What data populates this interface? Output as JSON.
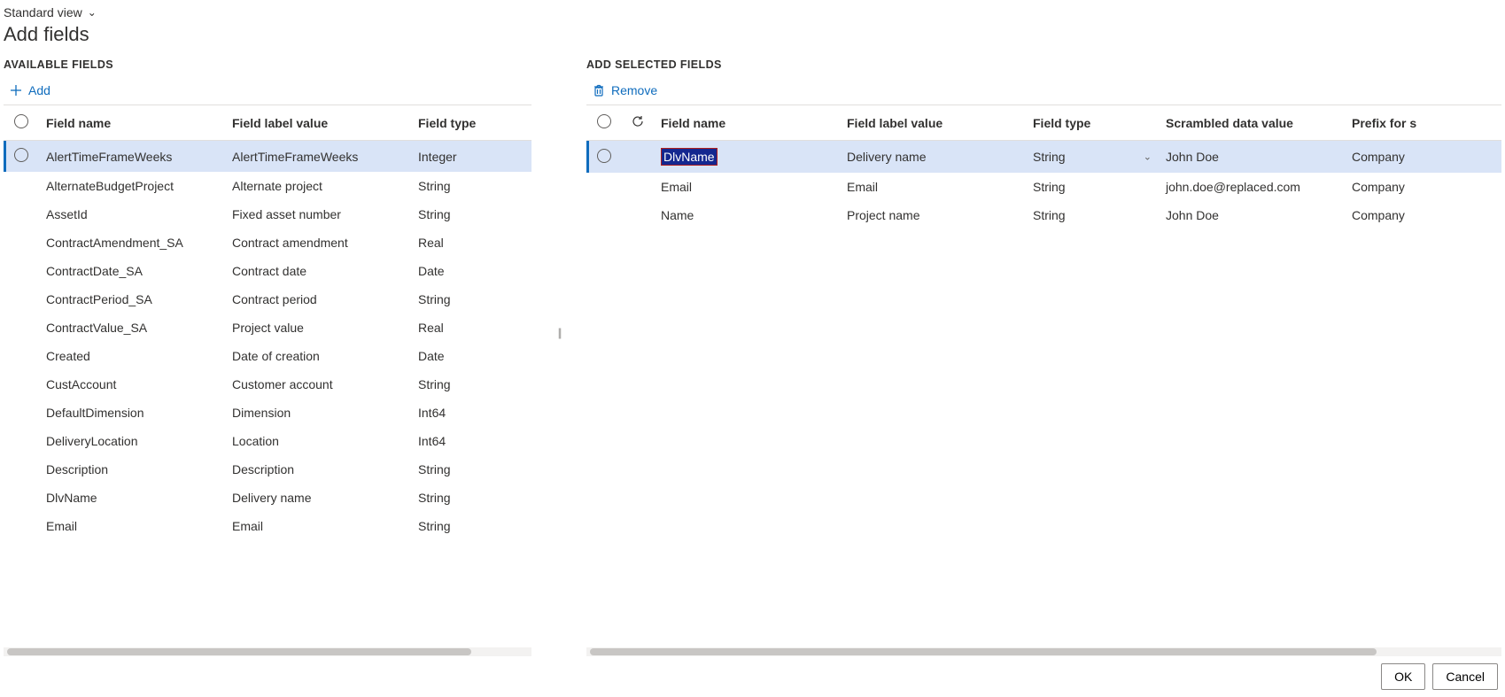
{
  "viewSelector": "Standard view",
  "pageTitle": "Add fields",
  "left": {
    "heading": "AVAILABLE FIELDS",
    "addLabel": "Add",
    "columns": {
      "name": "Field name",
      "label": "Field label value",
      "type": "Field type"
    },
    "rows": [
      {
        "name": "AlertTimeFrameWeeks",
        "label": "AlertTimeFrameWeeks",
        "type": "Integer",
        "selected": true
      },
      {
        "name": "AlternateBudgetProject",
        "label": "Alternate project",
        "type": "String"
      },
      {
        "name": "AssetId",
        "label": "Fixed asset number",
        "type": "String"
      },
      {
        "name": "ContractAmendment_SA",
        "label": "Contract amendment",
        "type": "Real"
      },
      {
        "name": "ContractDate_SA",
        "label": "Contract date",
        "type": "Date"
      },
      {
        "name": "ContractPeriod_SA",
        "label": "Contract period",
        "type": "String"
      },
      {
        "name": "ContractValue_SA",
        "label": "Project value",
        "type": "Real"
      },
      {
        "name": "Created",
        "label": "Date of creation",
        "type": "Date"
      },
      {
        "name": "CustAccount",
        "label": "Customer account",
        "type": "String"
      },
      {
        "name": "DefaultDimension",
        "label": "Dimension",
        "type": "Int64"
      },
      {
        "name": "DeliveryLocation",
        "label": "Location",
        "type": "Int64"
      },
      {
        "name": "Description",
        "label": "Description",
        "type": "String"
      },
      {
        "name": "DlvName",
        "label": "Delivery name",
        "type": "String"
      },
      {
        "name": "Email",
        "label": "Email",
        "type": "String"
      }
    ]
  },
  "right": {
    "heading": "ADD SELECTED FIELDS",
    "removeLabel": "Remove",
    "columns": {
      "name": "Field name",
      "label": "Field label value",
      "type": "Field type",
      "scrambled": "Scrambled data value",
      "prefix": "Prefix for s"
    },
    "rows": [
      {
        "name": "DlvName",
        "label": "Delivery name",
        "type": "String",
        "scrambled": "John Doe",
        "prefix": "Company",
        "selected": true,
        "editing": true,
        "showChevron": true
      },
      {
        "name": "Email",
        "label": "Email",
        "type": "String",
        "scrambled": "john.doe@replaced.com",
        "prefix": "Company"
      },
      {
        "name": "Name",
        "label": "Project name",
        "type": "String",
        "scrambled": "John Doe",
        "prefix": "Company"
      }
    ]
  },
  "footer": {
    "ok": "OK",
    "cancel": "Cancel"
  }
}
